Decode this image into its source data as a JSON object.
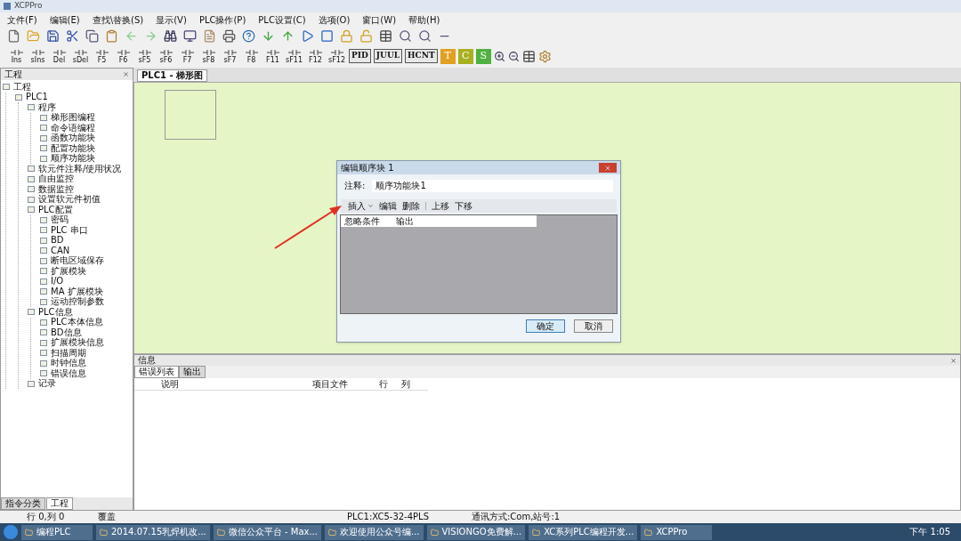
{
  "window": {
    "title": "XCPPro"
  },
  "menu": [
    "文件(F)",
    "编辑(E)",
    "查找\\替换(S)",
    "显示(V)",
    "PLC操作(P)",
    "PLC设置(C)",
    "选项(O)",
    "窗口(W)",
    "帮助(H)"
  ],
  "ladder_tools": [
    {
      "kind": "key",
      "label": "Ins"
    },
    {
      "kind": "key",
      "label": "sIns"
    },
    {
      "kind": "key",
      "label": "Del"
    },
    {
      "kind": "key",
      "label": "sDel"
    },
    {
      "kind": "key",
      "label": "F5"
    },
    {
      "kind": "key",
      "label": "F6"
    },
    {
      "kind": "key",
      "label": "sF5"
    },
    {
      "kind": "key",
      "label": "sF6"
    },
    {
      "kind": "key",
      "label": "F7"
    },
    {
      "kind": "key",
      "label": "sF8"
    },
    {
      "kind": "key",
      "label": "sF7"
    },
    {
      "kind": "key",
      "label": "F8"
    },
    {
      "kind": "key",
      "label": "F11"
    },
    {
      "kind": "key",
      "label": "sF11"
    },
    {
      "kind": "key",
      "label": "F12"
    },
    {
      "kind": "key",
      "label": "sF12"
    },
    {
      "kind": "block",
      "label": "PID"
    },
    {
      "kind": "block",
      "label": "JUUL"
    },
    {
      "kind": "block",
      "label": "HCNT"
    },
    {
      "kind": "letter",
      "label": "T",
      "color": "#e0a020"
    },
    {
      "kind": "letter",
      "label": "C",
      "color": "#a8b020"
    },
    {
      "kind": "letter",
      "label": "S",
      "color": "#50b040"
    }
  ],
  "project_panel": {
    "title": "工程",
    "tree": [
      {
        "label": "工程",
        "children": [
          {
            "label": "PLC1",
            "children": [
              {
                "label": "程序",
                "children": [
                  {
                    "label": "梯形图编程"
                  },
                  {
                    "label": "命令语编程"
                  },
                  {
                    "label": "函数功能块"
                  },
                  {
                    "label": "配置功能块"
                  },
                  {
                    "label": "顺序功能块"
                  }
                ]
              },
              {
                "label": "软元件注释/使用状况"
              },
              {
                "label": "自由监控"
              },
              {
                "label": "数据监控"
              },
              {
                "label": "设置软元件初值"
              },
              {
                "label": "PLC配置",
                "children": [
                  {
                    "label": "密码"
                  },
                  {
                    "label": "PLC 串口"
                  },
                  {
                    "label": "BD"
                  },
                  {
                    "label": "CAN"
                  },
                  {
                    "label": "断电区域保存"
                  },
                  {
                    "label": "扩展模块"
                  },
                  {
                    "label": "I/O"
                  },
                  {
                    "label": "MA 扩展模块"
                  },
                  {
                    "label": "运动控制参数"
                  }
                ]
              },
              {
                "label": "PLC信息",
                "children": [
                  {
                    "label": "PLC本体信息"
                  },
                  {
                    "label": "BD信息"
                  },
                  {
                    "label": "扩展模块信息"
                  },
                  {
                    "label": "扫描周期"
                  },
                  {
                    "label": "时钟信息"
                  },
                  {
                    "label": "错误信息"
                  }
                ]
              },
              {
                "label": "记录"
              }
            ]
          }
        ]
      }
    ],
    "tabs": [
      {
        "label": "指令分类",
        "selected": false
      },
      {
        "label": "工程",
        "selected": true
      }
    ]
  },
  "editor": {
    "tabs": [
      {
        "label": "PLC1 - 梯形图",
        "selected": true
      }
    ]
  },
  "dialog": {
    "title": "编辑顺序块 1",
    "comment_label": "注释:",
    "comment_value": "顺序功能块1",
    "toolbar": [
      "插入",
      "编辑",
      "删除",
      "上移",
      "下移"
    ],
    "columns": [
      "忽略条件",
      "输出"
    ],
    "buttons": [
      {
        "label": "确定",
        "selected": true
      },
      {
        "label": "取消",
        "selected": false
      }
    ]
  },
  "info_panel": {
    "title": "信息",
    "tabs": [
      {
        "label": "错误列表",
        "selected": true
      },
      {
        "label": "输出",
        "selected": false
      }
    ],
    "columns": [
      "说明",
      "项目文件",
      "行",
      "列"
    ]
  },
  "status_bar": [
    "行 0,列 0",
    "覆盖",
    "PLC1:XC5-32-4PLS",
    "通讯方式:Com,站号:1"
  ],
  "taskbar": {
    "items": [
      "编程PLC",
      "2014.07.15乳焊机改...",
      "微信公众平台 - Max...",
      "欢迎使用公众号编...",
      "VISIONGO免费解...",
      "XC系列PLC编程开发...",
      "XCPPro"
    ],
    "clock": "下午 1:05"
  }
}
